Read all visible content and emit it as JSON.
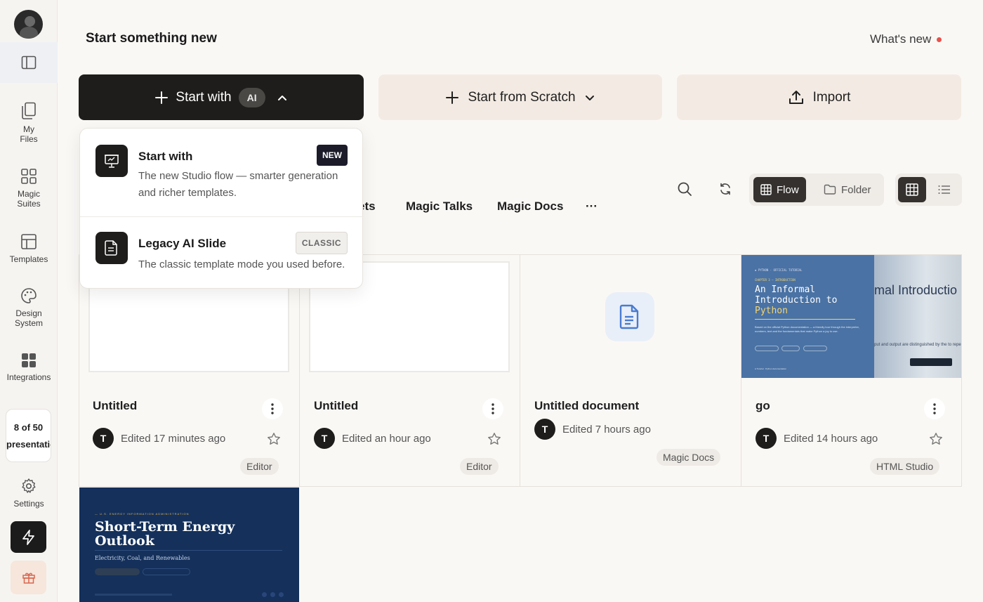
{
  "sidebar": {
    "items": [
      {
        "label": "My\nFiles",
        "icon": "files-icon"
      },
      {
        "label": "Magic\nSuites",
        "icon": "grid-icon"
      },
      {
        "label": "Templates",
        "icon": "template-icon"
      },
      {
        "label": "Design\nSystem",
        "icon": "palette-icon"
      },
      {
        "label": "Integrations",
        "icon": "integrations-icon"
      }
    ],
    "usage": {
      "count": "8 of 50",
      "label": "presentations"
    },
    "settings_label": "Settings"
  },
  "header": {
    "title": "Start something new",
    "whats_new": "What's new"
  },
  "actions": {
    "start_ai_label": "Start with",
    "start_ai_pill": "AI",
    "scratch_label": "Start from Scratch",
    "import_label": "Import"
  },
  "dropdown": {
    "items": [
      {
        "title": "Start with",
        "badge": "NEW",
        "desc": "The new Studio flow — smarter generation and richer templates."
      },
      {
        "title": "Legacy AI Slide",
        "badge": "CLASSIC",
        "desc": "The classic template mode you used before."
      }
    ]
  },
  "tabs": [
    "ets",
    "Magic Talks",
    "Magic Docs",
    "···"
  ],
  "view": {
    "flow": "Flow",
    "folder": "Folder",
    "active": "Flow",
    "layout_active": "grid"
  },
  "cards": [
    {
      "title": "Untitled",
      "avatar": "T",
      "edited": "Edited 17 minutes ago",
      "tag": "Editor"
    },
    {
      "title": "Untitled",
      "avatar": "T",
      "edited": "Edited an hour ago",
      "tag": "Editor"
    },
    {
      "title": "Untitled document",
      "avatar": "T",
      "edited": "Edited 7 hours ago",
      "tag": "Magic Docs"
    },
    {
      "title": "go",
      "avatar": "T",
      "edited": "Edited 14 hours ago",
      "tag": "HTML Studio"
    }
  ],
  "python_thumb": {
    "title_line1": "An Informal",
    "title_line2": "Introduction to",
    "title_line3": "Python",
    "right_title": "mal Introductio",
    "right_body": "put and output are distinguished by the\n to repeat the example, you must typ"
  },
  "energy_thumb": {
    "title": "Short-Term Energy Outlook",
    "subtitle": "Electricity, Coal, and Renewables"
  },
  "colors": {
    "accent_dark": "#1f1d1b",
    "background": "#faf8f5",
    "button_light": "#f3ebe3",
    "notify_dot": "#e5534b"
  }
}
